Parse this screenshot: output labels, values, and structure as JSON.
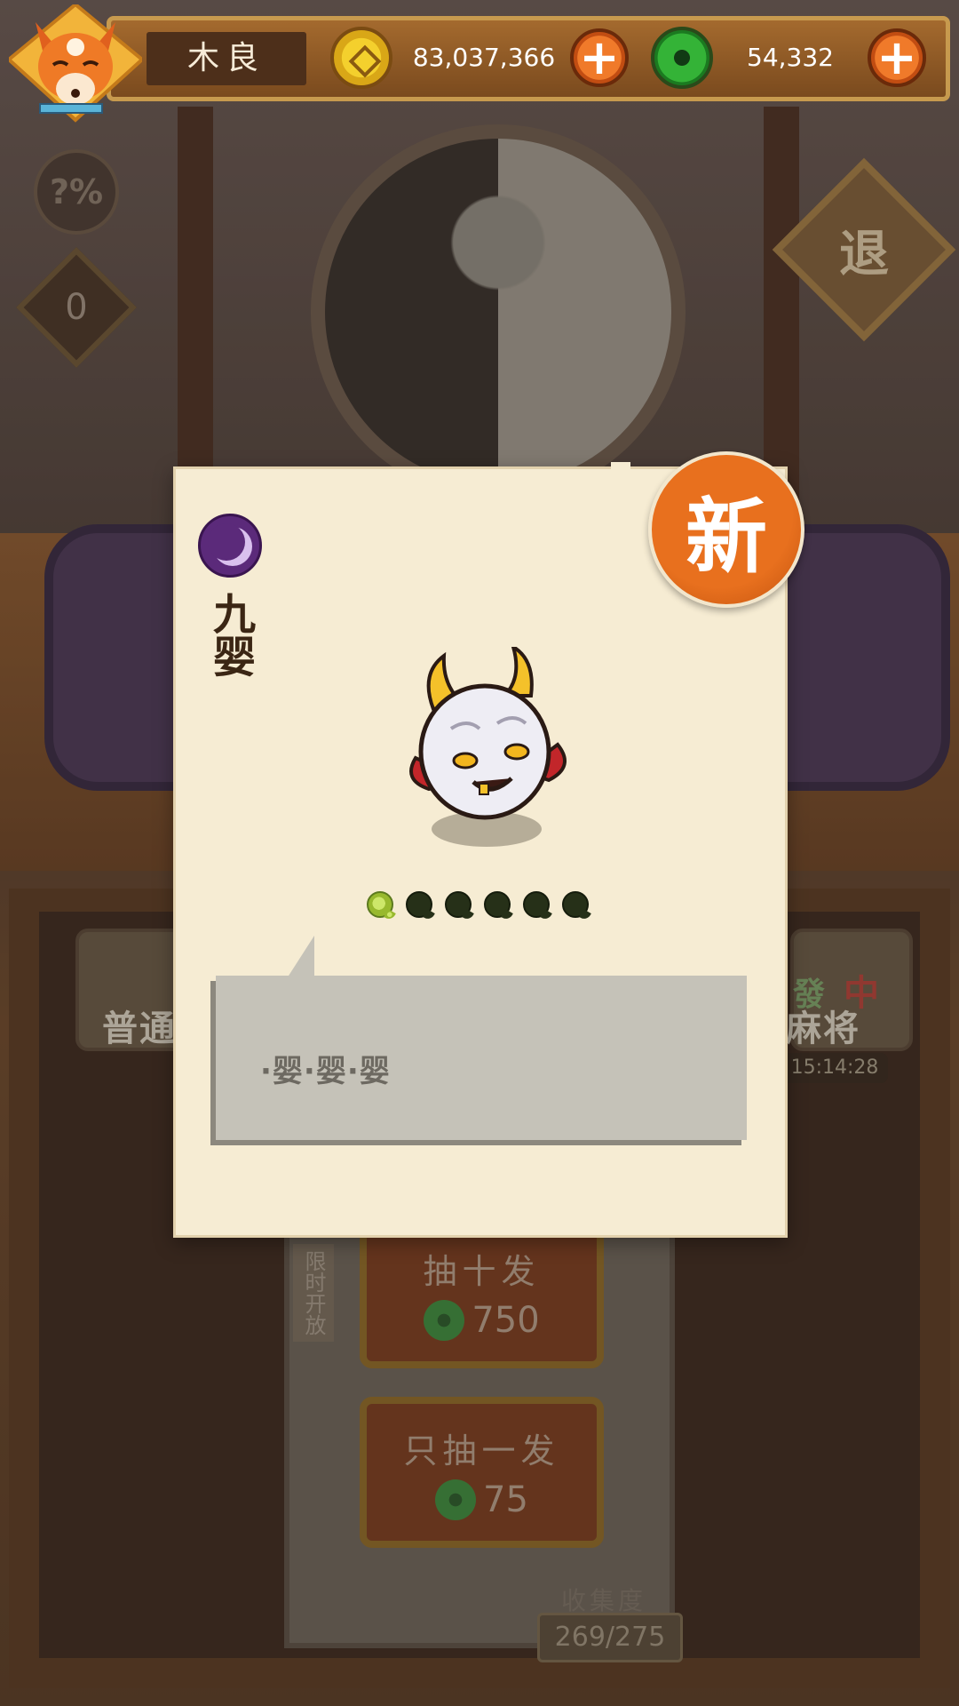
{
  "player": {
    "name": "木良"
  },
  "currency": {
    "gold_amount": "83,037,366",
    "jade_amount": "54,332",
    "add_label": "+"
  },
  "side": {
    "odds_label": "?%",
    "counter_value": "0",
    "exit_label": "退"
  },
  "background": {
    "mode_left_label": "普通",
    "mode_right_label": "麻将",
    "mode_right_tiles": [
      "發",
      "中"
    ],
    "timer": "15:14:28",
    "limited_label": "限时开放",
    "draw_ten_label": "抽十发",
    "draw_ten_cost": "750",
    "draw_one_label": "只抽一发",
    "draw_one_cost": "75",
    "collection_label": "收集度",
    "collection_value": "269/275"
  },
  "card": {
    "new_badge": "新",
    "yokai_name": "九婴",
    "element_icon": "moon-icon",
    "rarity": {
      "filled": 1,
      "total": 6
    },
    "quote": "·婴·婴·婴"
  },
  "colors": {
    "card_bg": "#f6ecd3",
    "new_badge": "#e8701e",
    "jade": "#34b337",
    "gold": "#f4d02d"
  }
}
